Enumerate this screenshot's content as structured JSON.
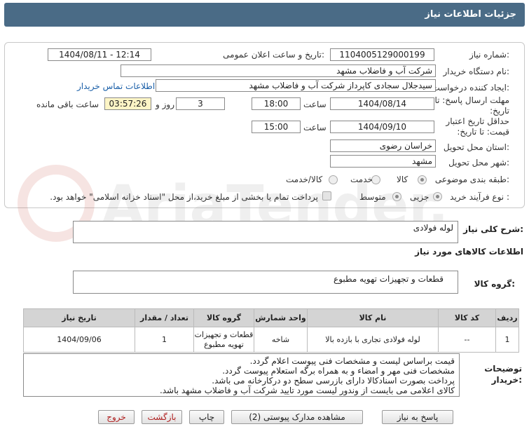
{
  "header": {
    "title": "جزئیات اطلاعات نیاز"
  },
  "fields": {
    "need_number_label": "شماره نیاز:",
    "need_number": "1104005129000199",
    "announce_label": "تاریخ و ساعت اعلان عمومی:",
    "announce_value": "1404/08/11 - 12:14",
    "buyer_org_label": "نام دستگاه خریدار:",
    "buyer_org": "شرکت آب و فاضلاب مشهد",
    "requester_label": "ایجاد کننده درخواست:",
    "requester": "سیدجلال سجادی کاپرداز شرکت آب و فاضلاب مشهد",
    "contact_link": "اطلاعات تماس خریدار",
    "reply_deadline_label": "مهلت ارسال پاسخ: تا تاریخ:",
    "reply_date": "1404/08/14",
    "time_label": "ساعت",
    "reply_time": "18:00",
    "days_value": "3",
    "days_label": "روز و",
    "remaining_time": "03:57:26",
    "remaining_label": "ساعت باقی مانده",
    "validity_label": "حداقل تاریخ اعتبار قیمت: تا تاریخ:",
    "validity_date": "1404/09/10",
    "validity_time": "15:00",
    "province_label": "استان محل تحویل:",
    "province": "خراسان رضوی",
    "city_label": "شهر محل تحویل:",
    "city": "مشهد",
    "category_label": "طبقه بندی موضوعی:",
    "category_options": [
      "کالا",
      "خدمت",
      "کالا/خدمت"
    ],
    "category_selected": "کالا",
    "process_label": "نوع فرآیند خرید :",
    "process_options": [
      "جزیی",
      "متوسط"
    ],
    "process_selected": "جزیی",
    "payment_note": "پرداخت تمام یا بخشی از مبلغ خرید،از محل \"اسناد خزانه اسلامی\" خواهد بود."
  },
  "description": {
    "label": "شرح کلی نیاز:",
    "value": "لوله فولادی"
  },
  "goods_section": {
    "title": "اطلاعات کالاهای مورد نیاز",
    "group_label": "گروه کالا:",
    "group_value": "قطعات و تجهیزات تهویه مطبوع"
  },
  "table": {
    "headers": [
      "ردیف",
      "کد کالا",
      "نام کالا",
      "واحد شمارش",
      "گروه کالا",
      "تعداد / مقدار",
      "تاریخ نیاز"
    ],
    "rows": [
      [
        "1",
        "--",
        "لوله فولادی تجاری با بازده بالا",
        "شاخه",
        "قطعات و تجهیزات تهویه مطبوع",
        "1",
        "1404/09/06"
      ]
    ]
  },
  "buyer_notes": {
    "label": "توضیحات خریدار:",
    "lines": [
      "قیمت براساس لیست و مشخصات فنی پیوست اعلام گردد.",
      "مشخصات فنی مهر و امضاء و به همراه برگه استعلام پیوست گردد.",
      "پرداخت بصورت اسنادکالا دارای بازرسی سطح دو درکارخانه می باشد.",
      "کالای اعلامی می بایست از وندور لیست مورد تایید شرکت آب و فاضلاب مشهد باشد."
    ]
  },
  "buttons": {
    "reply": "پاسخ به نیاز",
    "attachments": "مشاهده مدارک پیوستی (2)",
    "print": "چاپ",
    "back": "بازگشت",
    "exit": "خروج"
  },
  "watermark": {
    "text": "AriaTender.neT"
  },
  "colors": {
    "header": "#4a6b86",
    "remaining_bg": "#fdf5c6",
    "link": "#1a5fa8"
  }
}
